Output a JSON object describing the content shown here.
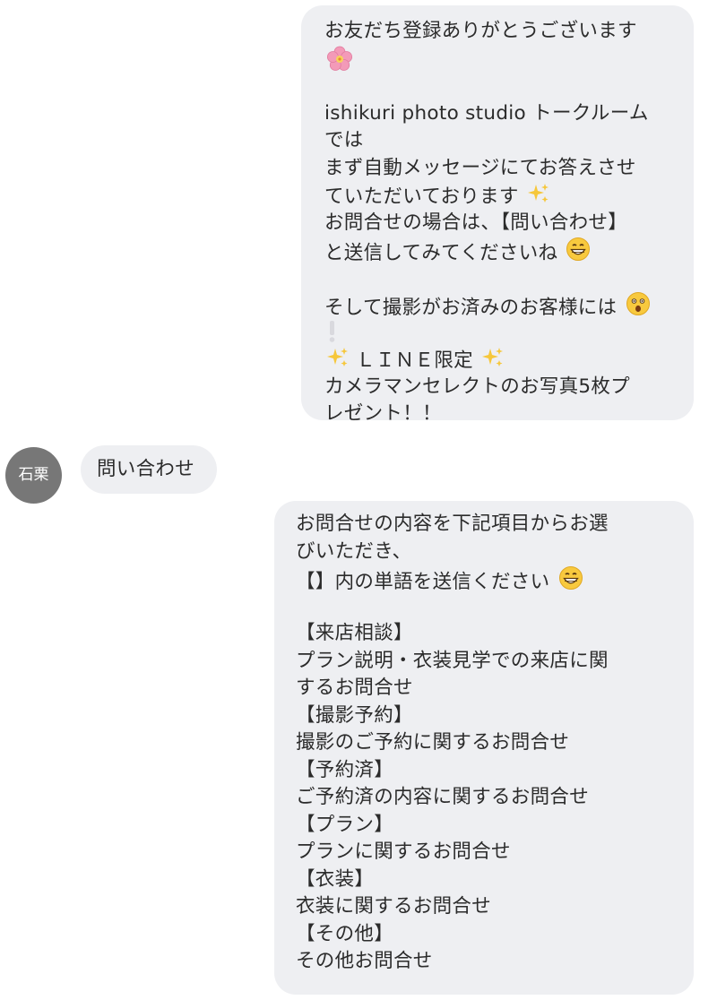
{
  "chat": {
    "welcome_message": {
      "lines": [
        "お友だち登録ありがとうございます",
        "",
        "",
        "ishikuri photo studio トークルーム",
        "では",
        "まず自動メッセージにてお答えさせ",
        "ていただいております",
        "お問合せの場合は、【問い合わせ】",
        "と送信してみてくださいね",
        "",
        "そして撮影がお済みのお客様には",
        "",
        "ＬＩＮＥ限定",
        "カメラマンセレクトのお写真5枚プ",
        "レゼント！！"
      ]
    },
    "user": {
      "avatar_label": "石栗",
      "message": "問い合わせ"
    },
    "inquiry_reply": {
      "lines": [
        "お問合せの内容を下記項目からお選",
        "びいただき、",
        "【】内の単語を送信ください",
        "",
        "【来店相談】",
        "プラン説明・衣装見学での来店に関",
        "するお問合せ",
        "【撮影予約】",
        "撮影のご予約に関するお問合せ",
        "【予約済】",
        "ご予約済の内容に関するお問合せ",
        "【プラン】",
        "プランに関するお問合せ",
        "【衣装】",
        "衣装に関するお問合せ",
        "【その他】",
        "その他お問合せ"
      ]
    }
  },
  "icons": {
    "flower": "cherry-blossom-icon",
    "sparkles": "sparkles-icon",
    "smile": "grinning-face-icon",
    "surprised": "astonished-face-icon",
    "exclamation": "exclamation-icon"
  },
  "colors": {
    "bubble": "#eeeff2",
    "avatar": "#777777",
    "text": "#2b2b2b"
  }
}
